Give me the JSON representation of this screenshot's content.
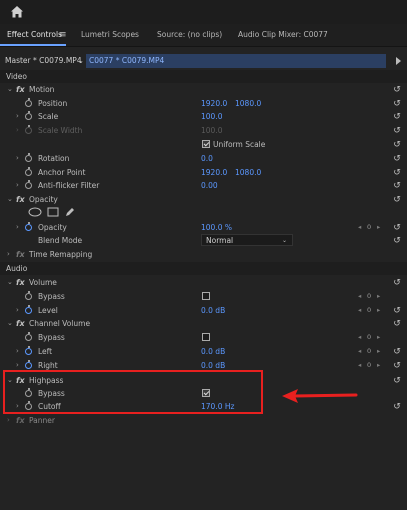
{
  "tabs": {
    "effect_controls": "Effect Controls",
    "menu_glyph": "≡",
    "lumetri": "Lumetri Scopes",
    "source": "Source: (no clips)",
    "audio_mixer": "Audio Clip Mixer: C0077"
  },
  "sequence": {
    "master": "Master * C0079.MP4",
    "caret": "⌄",
    "clip": "C0077 * C0079.MP4"
  },
  "video": {
    "section_label": "Video",
    "motion": {
      "label": "Motion",
      "position": {
        "label": "Position",
        "x": "1920.0",
        "y": "1080.0"
      },
      "scale": {
        "label": "Scale",
        "value": "100.0"
      },
      "scale_width": {
        "label": "Scale Width",
        "value": "100.0"
      },
      "uniform_scale": {
        "label": "Uniform Scale",
        "checked": true
      },
      "rotation": {
        "label": "Rotation",
        "value": "0.0"
      },
      "anchor_point": {
        "label": "Anchor Point",
        "x": "1920.0",
        "y": "1080.0"
      },
      "anti_flicker": {
        "label": "Anti-flicker Filter",
        "value": "0.00"
      }
    },
    "opacity": {
      "label": "Opacity",
      "opacity": {
        "label": "Opacity",
        "value": "100.0 %"
      },
      "blend_mode": {
        "label": "Blend Mode",
        "value": "Normal"
      }
    },
    "time_remapping": {
      "label": "Time Remapping"
    }
  },
  "audio": {
    "section_label": "Audio",
    "volume": {
      "label": "Volume",
      "bypass": {
        "label": "Bypass",
        "checked": false
      },
      "level": {
        "label": "Level",
        "value": "0.0 dB"
      }
    },
    "channel_volume": {
      "label": "Channel Volume",
      "bypass": {
        "label": "Bypass",
        "checked": false
      },
      "left": {
        "label": "Left",
        "value": "0.0 dB"
      },
      "right": {
        "label": "Right",
        "value": "0.0 dB"
      }
    },
    "highpass": {
      "label": "Highpass",
      "bypass": {
        "label": "Bypass",
        "checked": true
      },
      "cutoff": {
        "label": "Cutoff",
        "value": "170.0 Hz"
      }
    },
    "panner": {
      "label": "Panner"
    }
  },
  "keyframe_nav": {
    "value": "0"
  },
  "glyphs": {
    "reset": "↺",
    "fx": "fx",
    "chev_open": "⌄",
    "chev_closed": "›",
    "kf_prev": "◂",
    "kf_next": "▸"
  },
  "colors": {
    "accent": "#5b98ff",
    "highlight_box": "#e8201f",
    "panel_bg": "#232323"
  }
}
